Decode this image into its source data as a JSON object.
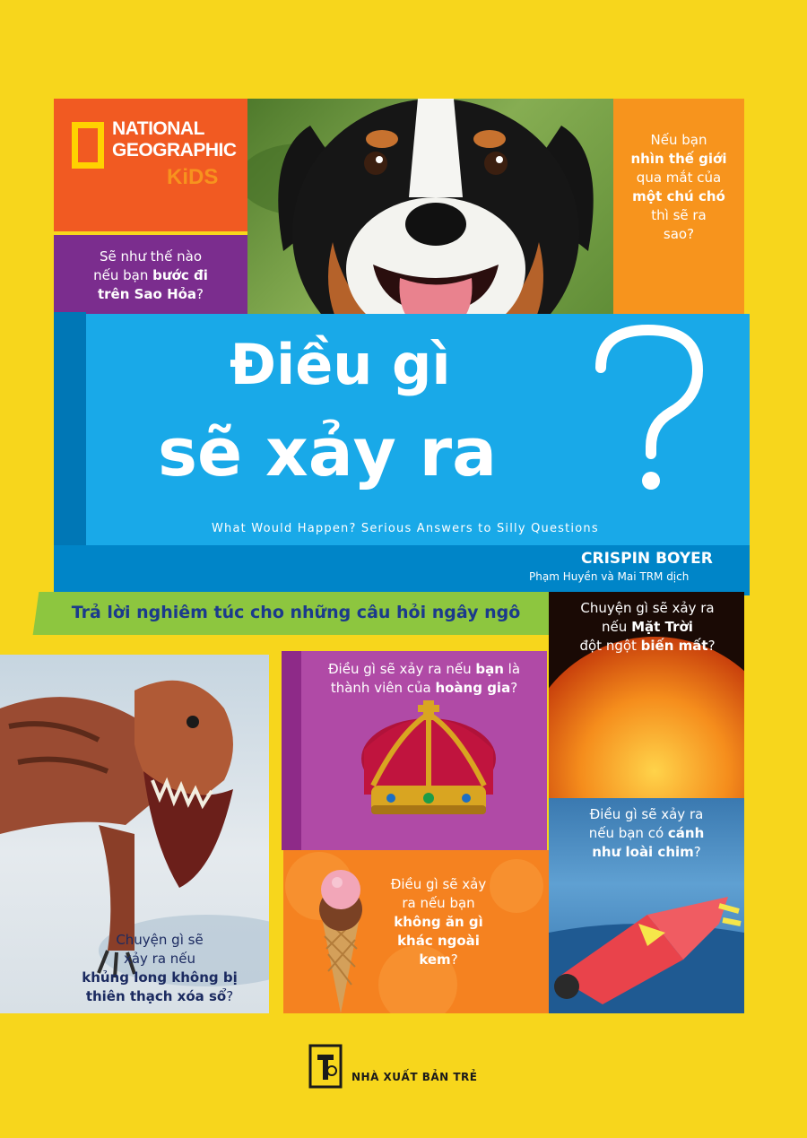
{
  "brand": {
    "line1": "NATIONAL",
    "line2": "GEOGRAPHIC",
    "kids": "KiDS"
  },
  "title": {
    "line1": "Điều gì",
    "line2": "sẽ xảy ra",
    "subtitle_en": "What Would Happen? Serious Answers to Silly Questions",
    "tagline": "Trả lời nghiêm túc cho những câu hỏi ngây ngô"
  },
  "credits": {
    "author": "CRISPIN BOYER",
    "translators": "Phạm Huyền và Mai TRM dịch"
  },
  "questions": {
    "mars": [
      "Sẽ như thế nào",
      "nếu bạn ",
      "bước đi",
      "trên Sao Hỏa",
      "?"
    ],
    "dog": [
      "Nếu bạn",
      "nhìn thế giới",
      "qua mắt của",
      "một chú chó",
      "thì sẽ ra",
      "sao?"
    ],
    "sun": [
      "Chuyện gì sẽ xảy ra",
      "nếu ",
      "Mặt Trời",
      "đột ngột ",
      "biến mất",
      "?"
    ],
    "crown": [
      "Điều gì sẽ xảy ra nếu ",
      "bạn",
      " là",
      "thành viên của ",
      "hoàng gia",
      "?"
    ],
    "bird": [
      "Điều gì sẽ xảy ra",
      "nếu bạn có ",
      "cánh",
      "như loài chim",
      "?"
    ],
    "ice": [
      "Điều gì sẽ xảy",
      "ra nếu bạn",
      "không ăn gì",
      "khác ngoài",
      "kem",
      "?"
    ],
    "dino": [
      "Chuyện gì sẽ",
      "xảy ra nếu",
      "khủng long không bị",
      "thiên thạch xóa sổ",
      "?"
    ]
  },
  "publisher": "NHÀ XUẤT BẢN TRẺ",
  "colors": {
    "background": "#f7d61c",
    "title_panel": "#19a9e8",
    "orange": "#f7941d",
    "purple": "#7b2d8e",
    "green": "#8dc63f"
  }
}
